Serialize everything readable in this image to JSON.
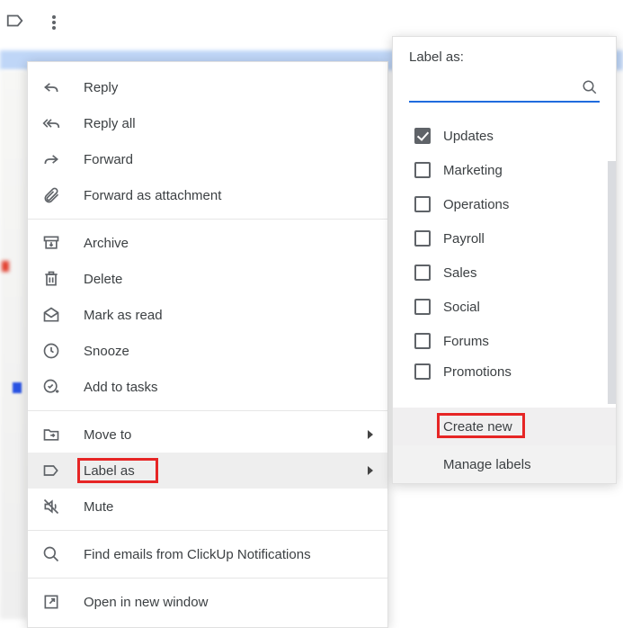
{
  "toolbar": {
    "labels_icon": "labels-icon",
    "more_icon": "more-icon"
  },
  "menu": {
    "reply": "Reply",
    "reply_all": "Reply all",
    "forward": "Forward",
    "forward_attachment": "Forward as attachment",
    "archive": "Archive",
    "delete": "Delete",
    "mark_read": "Mark as read",
    "snooze": "Snooze",
    "add_tasks": "Add to tasks",
    "move_to": "Move to",
    "label_as": "Label as",
    "mute": "Mute",
    "find_emails": "Find emails from ClickUp Notifications",
    "open_window": "Open in new window"
  },
  "submenu": {
    "title": "Label as:",
    "search_placeholder": "",
    "labels": [
      {
        "name": "Updates",
        "checked": true
      },
      {
        "name": "Marketing",
        "checked": false
      },
      {
        "name": "Operations",
        "checked": false
      },
      {
        "name": "Payroll",
        "checked": false
      },
      {
        "name": "Sales",
        "checked": false
      },
      {
        "name": "Social",
        "checked": false
      },
      {
        "name": "Forums",
        "checked": false
      },
      {
        "name": "Promotions",
        "checked": false
      }
    ],
    "create_new": "Create new",
    "manage_labels": "Manage labels"
  },
  "highlight": {
    "label_as": true,
    "create_new": true
  }
}
